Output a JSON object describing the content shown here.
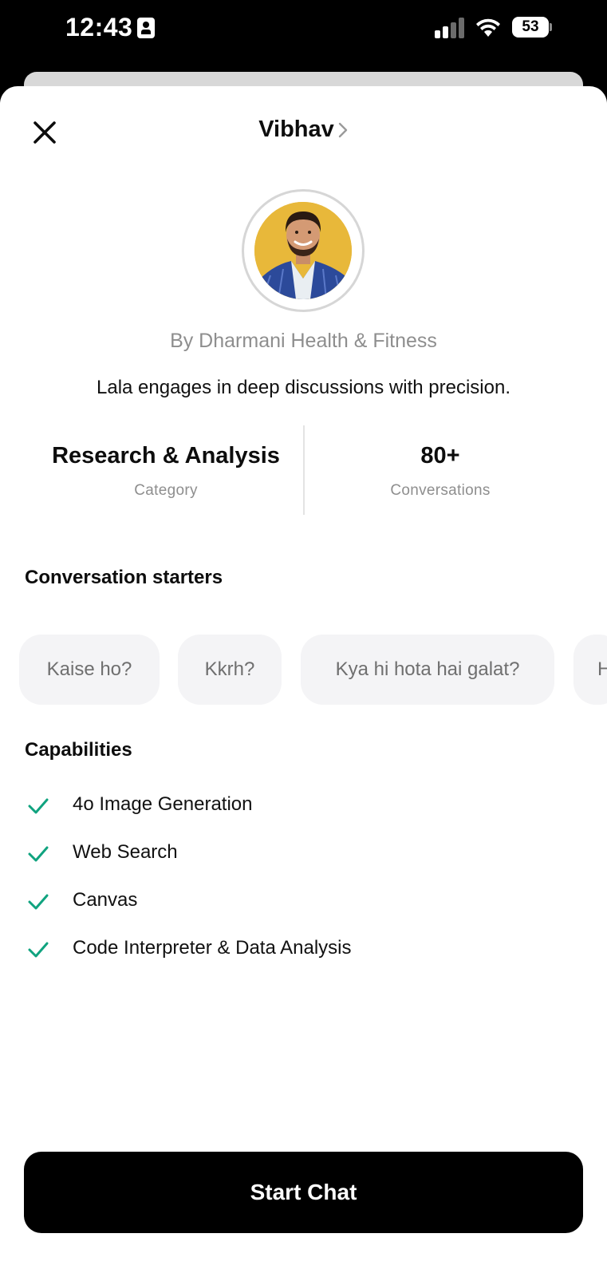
{
  "status_bar": {
    "time": "12:43",
    "battery": "53"
  },
  "header": {
    "title": "Vibhav"
  },
  "profile": {
    "byline": "By Dharmani Health & Fitness",
    "description": "Lala engages in deep discussions with precision."
  },
  "stats": [
    {
      "value": "Research & Analysis",
      "label": "Category"
    },
    {
      "value": "80+",
      "label": "Conversations"
    }
  ],
  "starters": {
    "title": "Conversation starters",
    "items": [
      "Kaise ho?",
      "Kkrh?",
      "Kya hi hota hai galat?",
      "H"
    ]
  },
  "capabilities": {
    "title": "Capabilities",
    "items": [
      "4o Image Generation",
      "Web Search",
      "Canvas",
      "Code Interpreter & Data Analysis"
    ]
  },
  "actions": {
    "start_chat": "Start Chat"
  },
  "colors": {
    "check": "#10a37f",
    "chip_bg": "#f4f4f6",
    "avatar_bg": "#e8b83a"
  }
}
